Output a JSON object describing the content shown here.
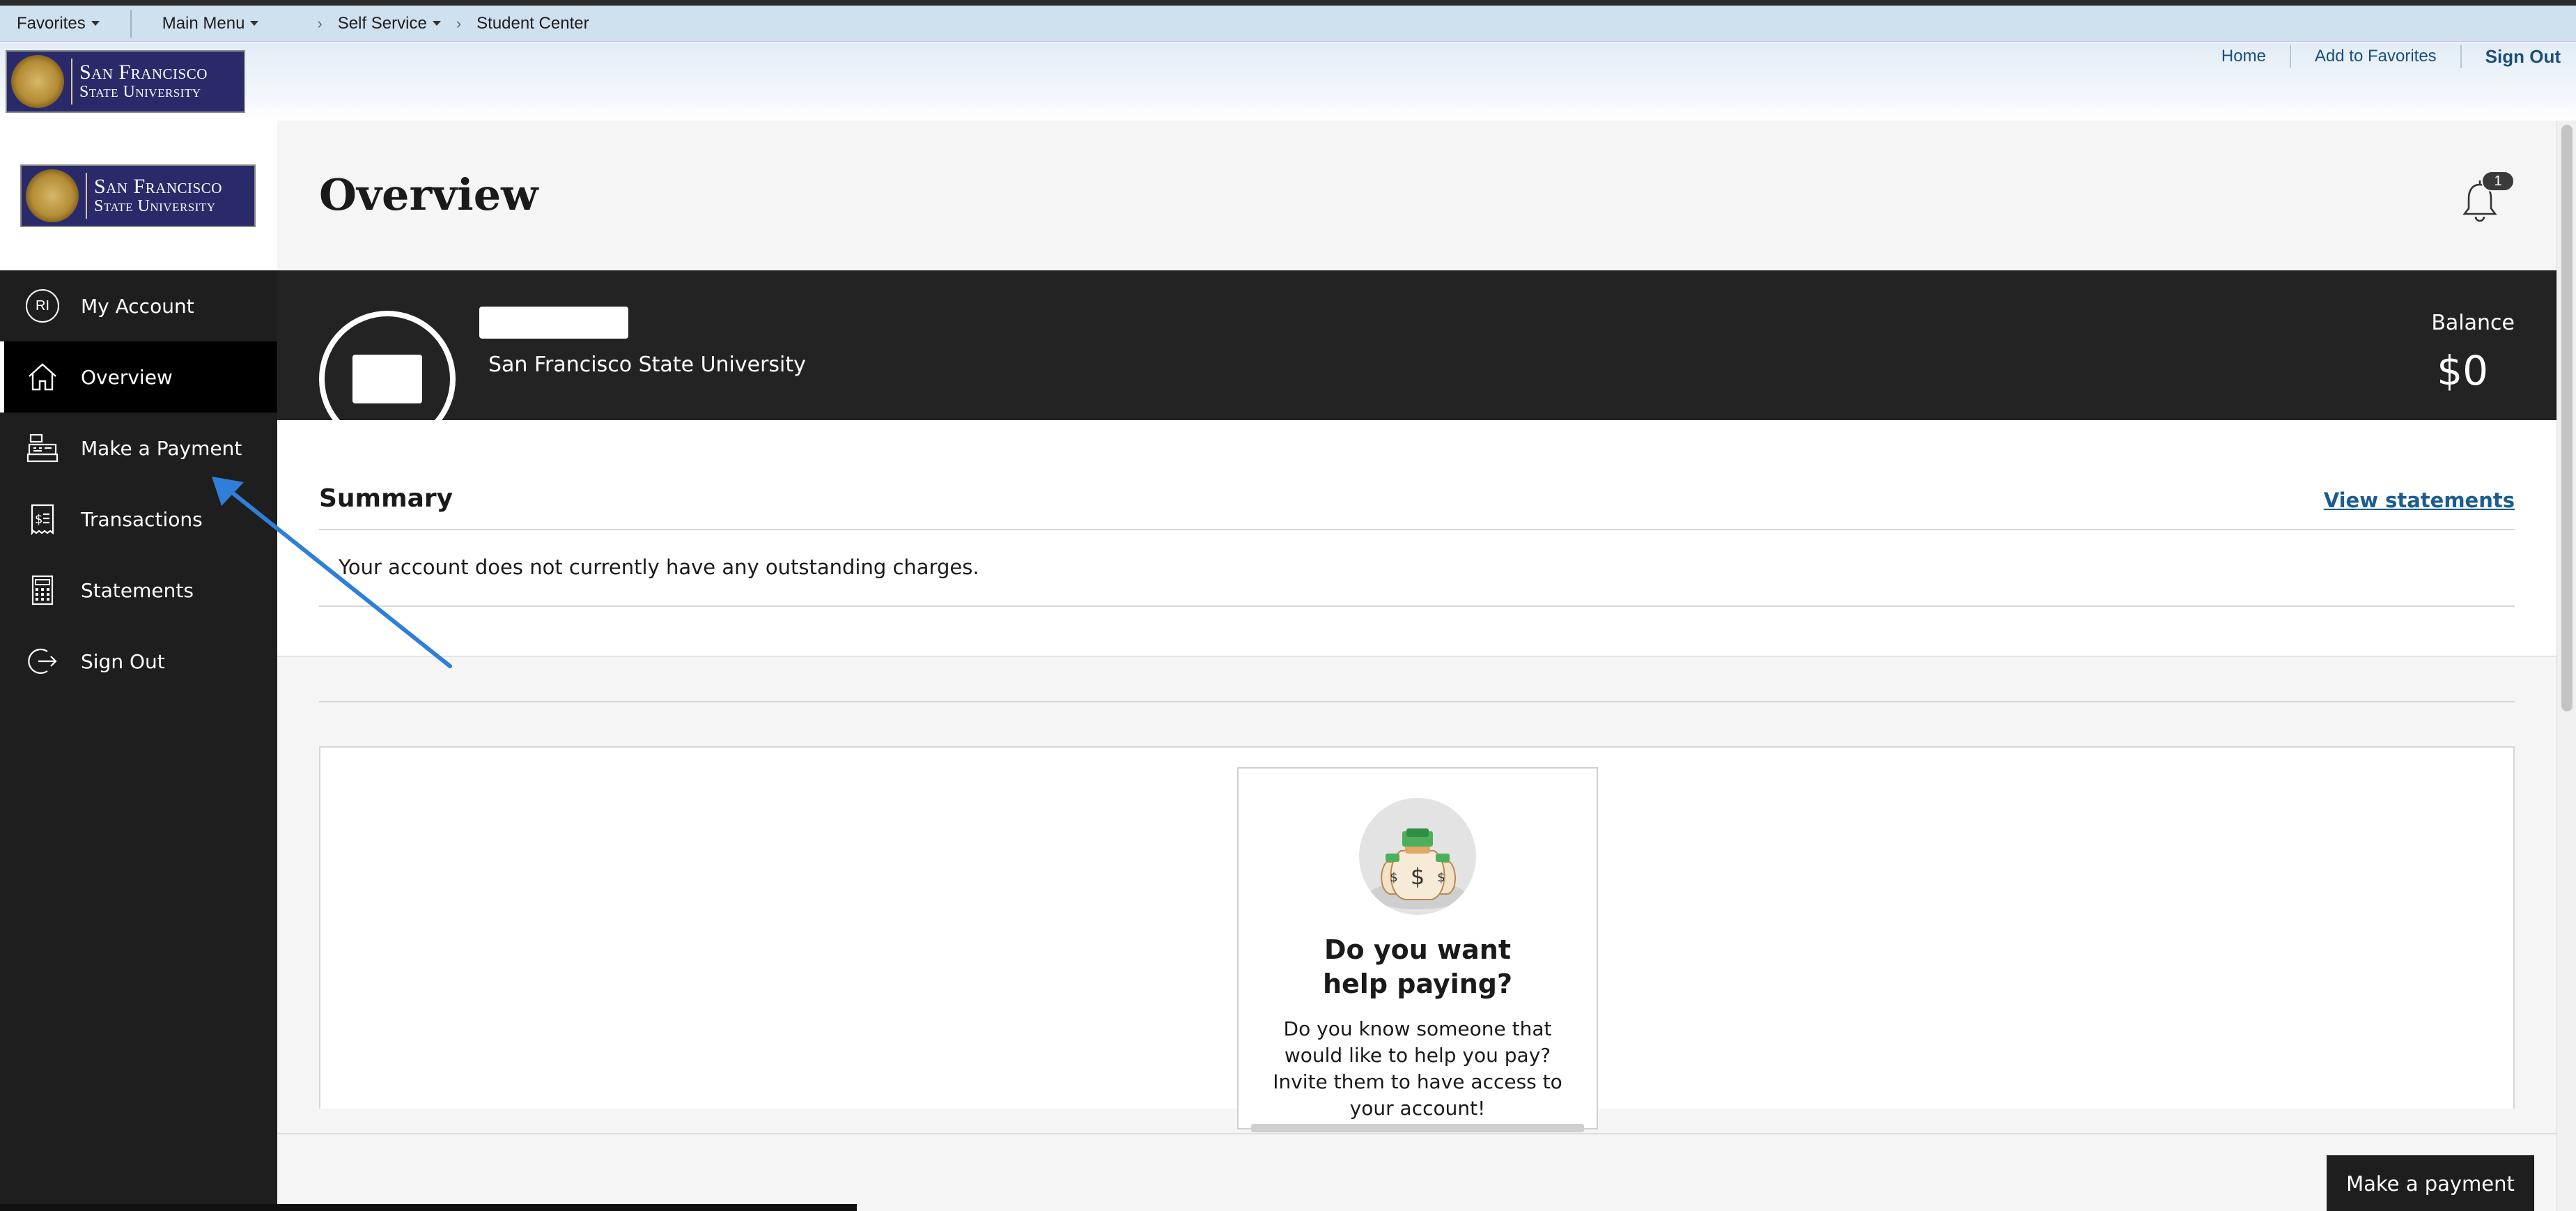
{
  "ps_nav": {
    "favorites": "Favorites",
    "main_menu": "Main Menu",
    "breadcrumbs": [
      "Self Service",
      "Student Center"
    ]
  },
  "header": {
    "logo": {
      "line1": "San Francisco",
      "line2": "State University"
    },
    "links": {
      "home": "Home",
      "add_to_favorites": "Add to Favorites",
      "sign_out": "Sign Out"
    }
  },
  "sidebar": {
    "logo": {
      "line1": "San Francisco",
      "line2": "State University"
    },
    "avatar_initials": "RI",
    "items": [
      {
        "label": "My Account",
        "icon": "avatar-icon",
        "active": false
      },
      {
        "label": "Overview",
        "icon": "home-icon",
        "active": true
      },
      {
        "label": "Make a Payment",
        "icon": "cash-register-icon",
        "active": false
      },
      {
        "label": "Transactions",
        "icon": "receipt-icon",
        "active": false
      },
      {
        "label": "Statements",
        "icon": "calculator-icon",
        "active": false
      },
      {
        "label": "Sign Out",
        "icon": "sign-out-icon",
        "active": false
      }
    ]
  },
  "main": {
    "title": "Overview",
    "notifications": {
      "icon": "bell-icon",
      "count": "1"
    },
    "account": {
      "institution": "San Francisco State University",
      "balance_label": "Balance",
      "balance_value": "$0"
    },
    "summary": {
      "title": "Summary",
      "view_statements": "View statements",
      "message": "Your account does not currently have any outstanding charges."
    },
    "help_card": {
      "icon": "money-bags-icon",
      "title_line1": "Do you want",
      "title_line2": "help paying?",
      "text": "Do you know someone that would like to help you pay? Invite them to have access to your account!"
    },
    "footer": {
      "pay_button": "Make a payment"
    }
  },
  "colors": {
    "sidebar_bg": "#1e1e1e",
    "account_band_bg": "#232323",
    "link_blue": "#1c5c8f",
    "annotation_arrow": "#2f7fd8",
    "nav_bar_bg": "#cfe0ef"
  }
}
